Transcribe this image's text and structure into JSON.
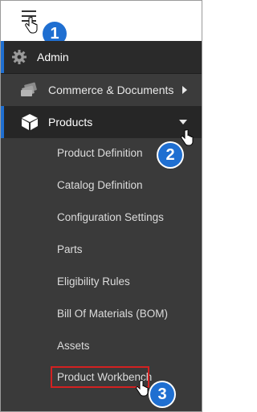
{
  "header": {
    "menu_icon": "hamburger-icon"
  },
  "callouts": [
    "1",
    "2",
    "3"
  ],
  "nav": {
    "admin": {
      "label": "Admin",
      "icon": "gear-icon"
    },
    "commerce": {
      "label": "Commerce & Documents",
      "icon": "documents-icon"
    },
    "products": {
      "label": "Products",
      "icon": "cube-icon"
    }
  },
  "submenu": {
    "items": [
      "Product Definition",
      "Catalog Definition",
      "Configuration Settings",
      "Parts",
      "Eligibility Rules",
      "Bill Of Materials (BOM)",
      "Assets",
      "Product Workbench"
    ]
  },
  "colors": {
    "accent": "#1f6fd1",
    "highlight": "#d32121",
    "sidebar_bg": "#3a3a3a"
  }
}
